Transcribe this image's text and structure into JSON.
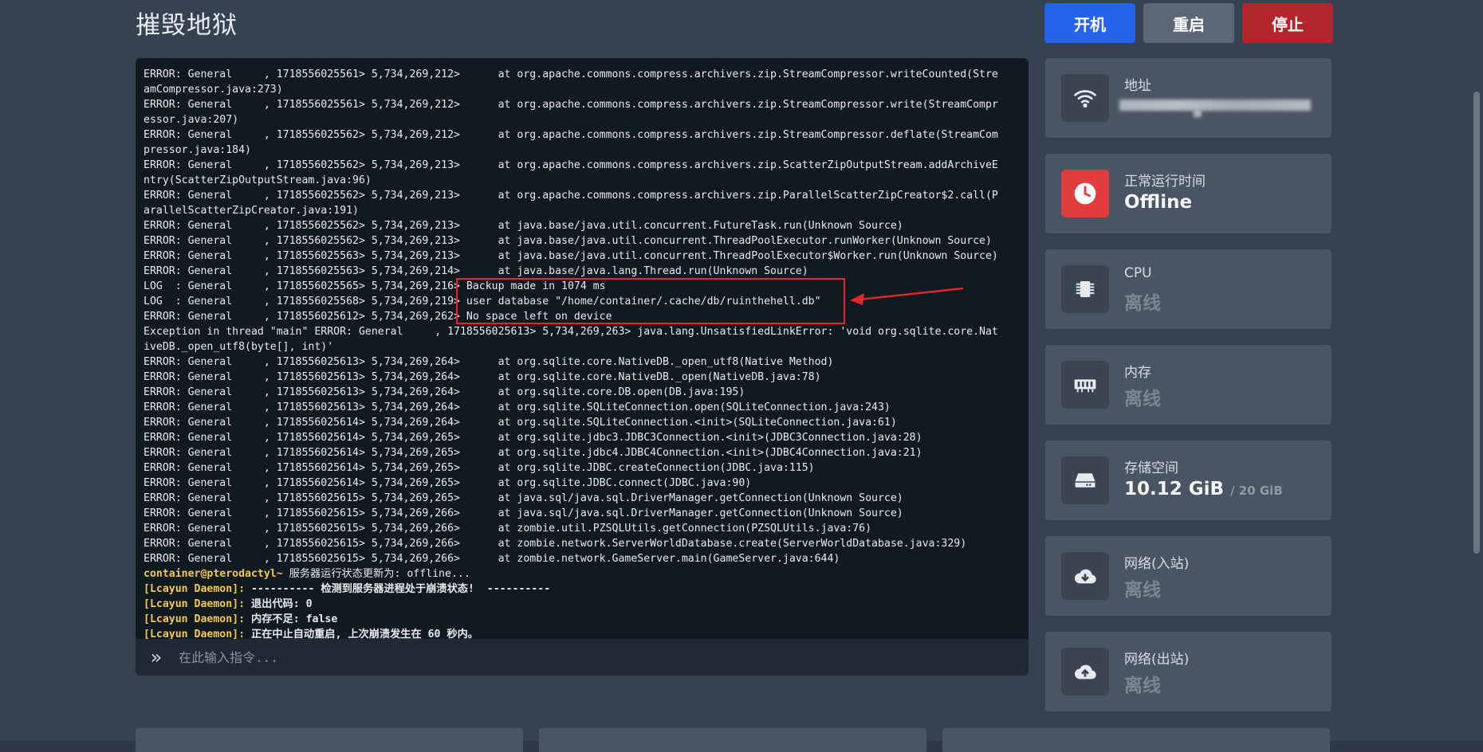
{
  "server": {
    "title": "摧毁地狱"
  },
  "power": {
    "start": "开机",
    "restart": "重启",
    "stop": "停止"
  },
  "console": {
    "lines": [
      "ERROR: General     , 1718556025561> 5,734,269,212>      at org.apache.commons.compress.archivers.zip.StreamCompressor.writeCounted(Stre",
      "amCompressor.java:273)",
      "ERROR: General     , 1718556025561> 5,734,269,212>      at org.apache.commons.compress.archivers.zip.StreamCompressor.write(StreamCompr",
      "essor.java:207)",
      "ERROR: General     , 1718556025562> 5,734,269,212>      at org.apache.commons.compress.archivers.zip.StreamCompressor.deflate(StreamCom",
      "pressor.java:184)",
      "ERROR: General     , 1718556025562> 5,734,269,213>      at org.apache.commons.compress.archivers.zip.ScatterZipOutputStream.addArchiveE",
      "ntry(ScatterZipOutputStream.java:96)",
      "ERROR: General     , 1718556025562> 5,734,269,213>      at org.apache.commons.compress.archivers.zip.ParallelScatterZipCreator$2.call(P",
      "arallelScatterZipCreator.java:191)",
      "ERROR: General     , 1718556025562> 5,734,269,213>      at java.base/java.util.concurrent.FutureTask.run(Unknown Source)",
      "ERROR: General     , 1718556025562> 5,734,269,213>      at java.base/java.util.concurrent.ThreadPoolExecutor.runWorker(Unknown Source)",
      "ERROR: General     , 1718556025563> 5,734,269,213>      at java.base/java.util.concurrent.ThreadPoolExecutor$Worker.run(Unknown Source)",
      "ERROR: General     , 1718556025563> 5,734,269,214>      at java.base/java.lang.Thread.run(Unknown Source)",
      "LOG  : General     , 1718556025565> 5,734,269,216> Backup made in 1074 ms",
      "LOG  : General     , 1718556025568> 5,734,269,219> user database \"/home/container/.cache/db/ruinthehell.db\"",
      "ERROR: General     , 1718556025612> 5,734,269,262> No space left on device",
      "Exception in thread \"main\" ERROR: General     , 1718556025613> 5,734,269,263> java.lang.UnsatisfiedLinkError: 'void org.sqlite.core.Nat",
      "iveDB._open_utf8(byte[], int)'",
      "ERROR: General     , 1718556025613> 5,734,269,264>      at org.sqlite.core.NativeDB._open_utf8(Native Method)",
      "ERROR: General     , 1718556025613> 5,734,269,264>      at org.sqlite.core.NativeDB._open(NativeDB.java:78)",
      "ERROR: General     , 1718556025613> 5,734,269,264>      at org.sqlite.core.DB.open(DB.java:195)",
      "ERROR: General     , 1718556025613> 5,734,269,264>      at org.sqlite.SQLiteConnection.open(SQLiteConnection.java:243)",
      "ERROR: General     , 1718556025614> 5,734,269,264>      at org.sqlite.SQLiteConnection.<init>(SQLiteConnection.java:61)",
      "ERROR: General     , 1718556025614> 5,734,269,265>      at org.sqlite.jdbc3.JDBC3Connection.<init>(JDBC3Connection.java:28)",
      "ERROR: General     , 1718556025614> 5,734,269,265>      at org.sqlite.jdbc4.JDBC4Connection.<init>(JDBC4Connection.java:21)",
      "ERROR: General     , 1718556025614> 5,734,269,265>      at org.sqlite.JDBC.createConnection(JDBC.java:115)",
      "ERROR: General     , 1718556025614> 5,734,269,265>      at org.sqlite.JDBC.connect(JDBC.java:90)",
      "ERROR: General     , 1718556025615> 5,734,269,265>      at java.sql/java.sql.DriverManager.getConnection(Unknown Source)",
      "ERROR: General     , 1718556025615> 5,734,269,266>      at java.sql/java.sql.DriverManager.getConnection(Unknown Source)",
      "ERROR: General     , 1718556025615> 5,734,269,266>      at zombie.util.PZSQLUtils.getConnection(PZSQLUtils.java:76)",
      "ERROR: General     , 1718556025615> 5,734,269,266>      at zombie.network.ServerWorldDatabase.create(ServerWorldDatabase.java:329)",
      "ERROR: General     , 1718556025615> 5,734,269,266>      at zombie.network.GameServer.main(GameServer.java:644)"
    ],
    "status_lines": [
      {
        "prefix": "container@pterodactyl~",
        "text": " 服务器运行状态更新为: offline..."
      },
      {
        "prefix": "[Lcayun Daemon]:",
        "text": " ---------- 检测到服务器进程处于崩溃状态!  ----------"
      },
      {
        "prefix": "[Lcayun Daemon]:",
        "text": " 退出代码: 0"
      },
      {
        "prefix": "[Lcayun Daemon]:",
        "text": " 内存不足: false"
      },
      {
        "prefix": "[Lcayun Daemon]:",
        "text": " 正在中止自动重启, 上次崩溃发生在 60 秒内。"
      }
    ],
    "command_placeholder": "在此输入指令...",
    "prompt_icon": "double-chevron-right-icon"
  },
  "stats": [
    {
      "icon": "wifi-icon",
      "label": "地址",
      "value": ""
    },
    {
      "icon": "clock-icon",
      "label": "正常运行时间",
      "value": "Offline"
    },
    {
      "icon": "cpu-icon",
      "label": "CPU",
      "value": "离线"
    },
    {
      "icon": "memory-icon",
      "label": "内存",
      "value": "离线"
    },
    {
      "icon": "hard-drive-icon",
      "label": "存储空间",
      "value": "10.12 GiB",
      "sub": "/ 20 GiB"
    },
    {
      "icon": "cloud-download-icon",
      "label": "网络(入站)",
      "value": "离线"
    },
    {
      "icon": "cloud-upload-icon",
      "label": "网络(出站)",
      "value": "离线"
    }
  ],
  "colors": {
    "start": "#2563eb",
    "restart": "#5b6776",
    "stop": "#b3262d",
    "uptime_icon": "#e23d3d",
    "annotation": "#e3262b"
  }
}
